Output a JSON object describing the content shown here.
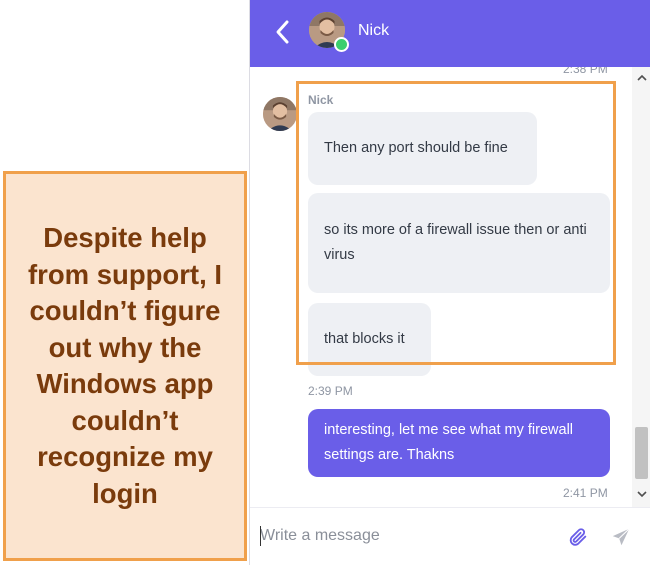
{
  "callout": {
    "text": "Despite help from support, I couldn’t figure out why the Windows app couldn’t recognize my login"
  },
  "header": {
    "contact_name": "Nick",
    "online": true,
    "back_icon": "chevron-left-icon"
  },
  "messages": {
    "top_time": "2:38 PM",
    "sender": "Nick",
    "incoming": [
      "Then any port should be fine",
      "so its more of a firewall issue then or anti virus",
      "that blocks it"
    ],
    "incoming_time": "2:39 PM",
    "outgoing": [
      "interesting, let me see what my firewall settings are. Thakns"
    ],
    "outgoing_time": "2:41 PM"
  },
  "composer": {
    "placeholder": "Write a message",
    "attach_icon": "paperclip-icon",
    "send_icon": "send-icon"
  },
  "colors": {
    "accent": "#6a5ee8",
    "highlight": "#f0a04b",
    "callout_bg": "#fbe4cf",
    "callout_text": "#7a3b0c",
    "online": "#3ccf6e"
  }
}
